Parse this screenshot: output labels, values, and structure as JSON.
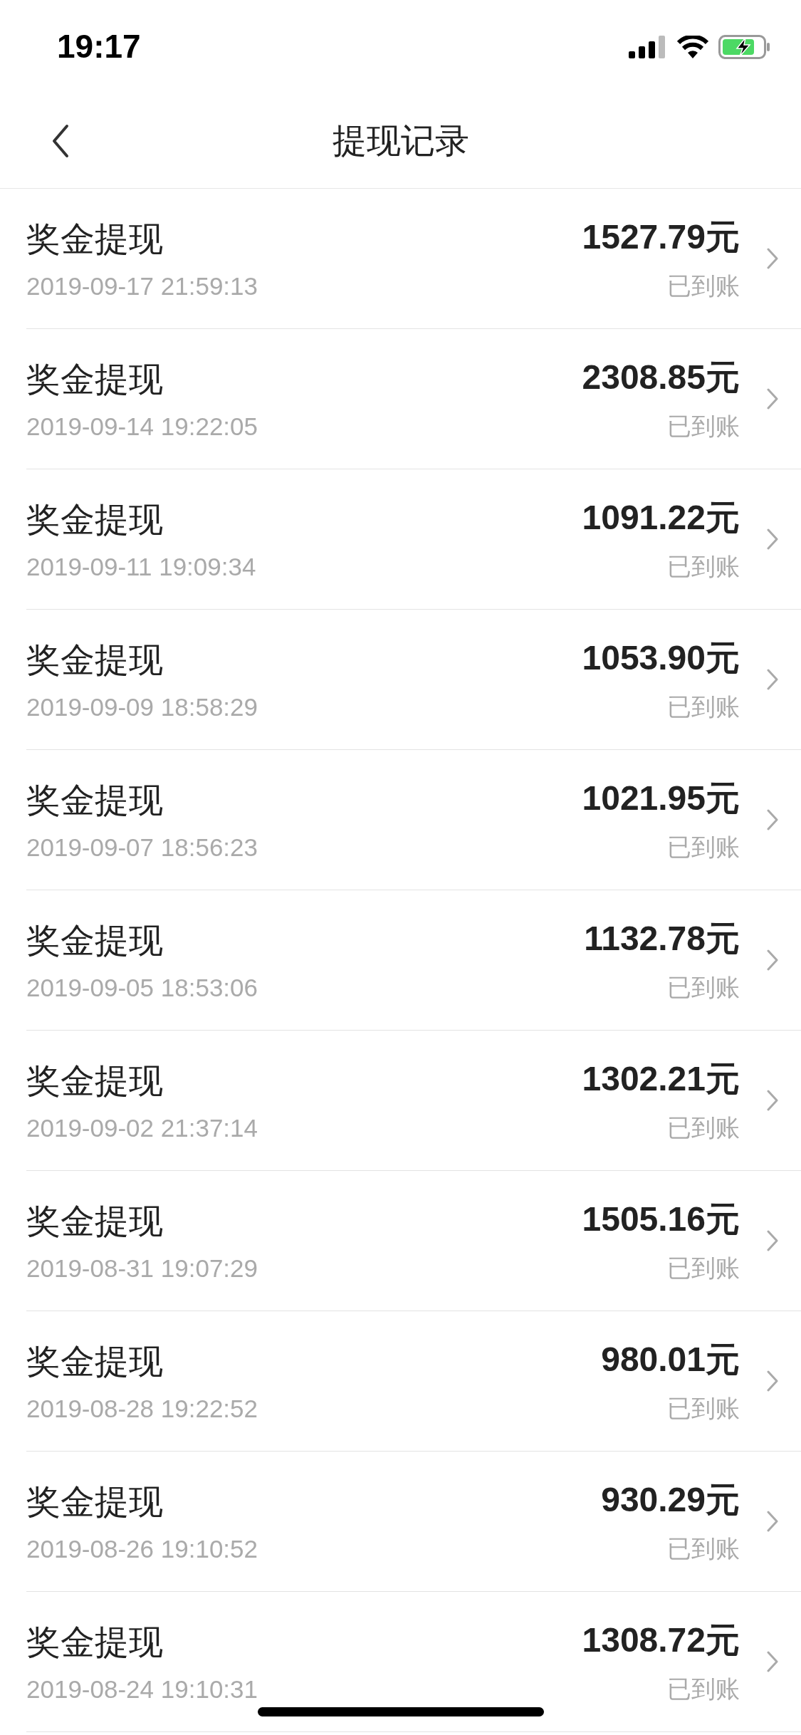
{
  "status_bar": {
    "time": "19:17"
  },
  "nav": {
    "title": "提现记录"
  },
  "records": [
    {
      "title": "奖金提现",
      "time": "2019-09-17 21:59:13",
      "amount": "1527.79元",
      "status": "已到账"
    },
    {
      "title": "奖金提现",
      "time": "2019-09-14 19:22:05",
      "amount": "2308.85元",
      "status": "已到账"
    },
    {
      "title": "奖金提现",
      "time": "2019-09-11 19:09:34",
      "amount": "1091.22元",
      "status": "已到账"
    },
    {
      "title": "奖金提现",
      "time": "2019-09-09 18:58:29",
      "amount": "1053.90元",
      "status": "已到账"
    },
    {
      "title": "奖金提现",
      "time": "2019-09-07 18:56:23",
      "amount": "1021.95元",
      "status": "已到账"
    },
    {
      "title": "奖金提现",
      "time": "2019-09-05 18:53:06",
      "amount": "1132.78元",
      "status": "已到账"
    },
    {
      "title": "奖金提现",
      "time": "2019-09-02 21:37:14",
      "amount": "1302.21元",
      "status": "已到账"
    },
    {
      "title": "奖金提现",
      "time": "2019-08-31 19:07:29",
      "amount": "1505.16元",
      "status": "已到账"
    },
    {
      "title": "奖金提现",
      "time": "2019-08-28 19:22:52",
      "amount": "980.01元",
      "status": "已到账"
    },
    {
      "title": "奖金提现",
      "time": "2019-08-26 19:10:52",
      "amount": "930.29元",
      "status": "已到账"
    },
    {
      "title": "奖金提现",
      "time": "2019-08-24 19:10:31",
      "amount": "1308.72元",
      "status": "已到账"
    }
  ]
}
